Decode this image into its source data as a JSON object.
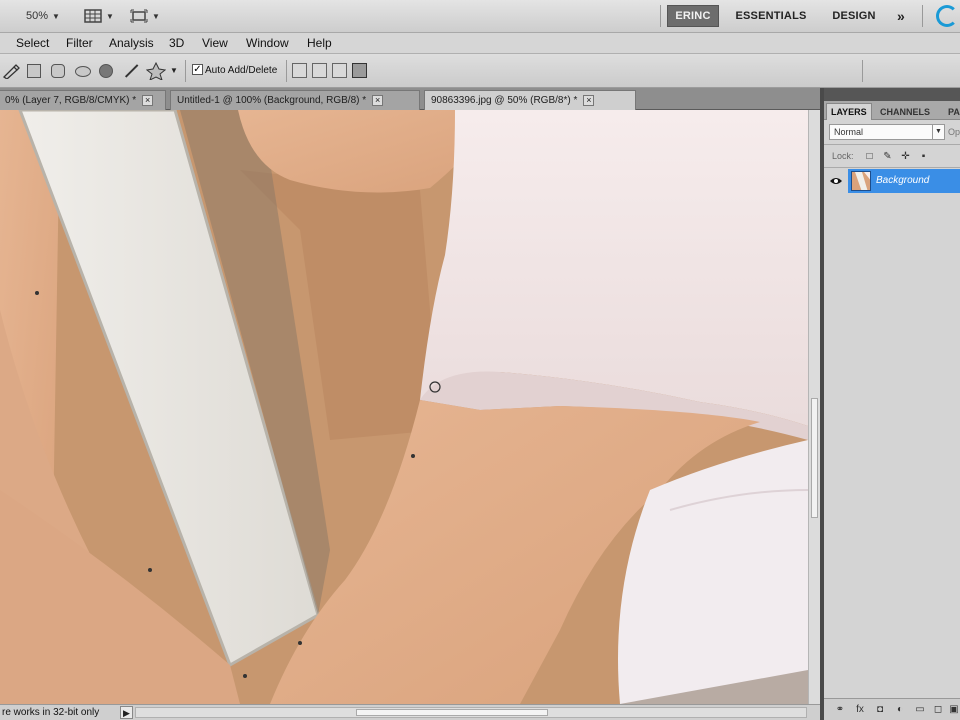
{
  "appbar": {
    "zoom_value": "50%",
    "workspaces": [
      "ERINC",
      "ESSENTIALS",
      "DESIGN"
    ],
    "active_workspace": "ERINC",
    "more_label": "»"
  },
  "menu": [
    "Select",
    "Filter",
    "Analysis",
    "3D",
    "View",
    "Window",
    "Help"
  ],
  "options": {
    "auto_add_delete_checked": true,
    "auto_add_delete_label": "Auto Add/Delete"
  },
  "tabs": [
    {
      "label": "0% (Layer 7, RGB/8/CMYK) *",
      "active": false
    },
    {
      "label": "Untitled-1 @ 100% (Background, RGB/8) *",
      "active": false
    },
    {
      "label": "90863396.jpg @ 50% (RGB/8*) *",
      "active": true
    }
  ],
  "status": {
    "text": "re works in 32-bit only"
  },
  "panel": {
    "tabs": [
      "LAYERS",
      "CHANNELS",
      "PA"
    ],
    "active_tab": "LAYERS",
    "blend_mode": "Normal",
    "opacity_label": "Op",
    "lock_label": "Lock:",
    "layers": [
      {
        "name": "Background",
        "selected": true,
        "visible": true
      }
    ]
  },
  "colors": {
    "selected_layer": "#3a8ee6",
    "active_workspace_bg": "#6d6d6d",
    "cs_live": "#1a9ad6"
  },
  "icons": {
    "view_extras": "view-extras-icon",
    "arrange": "arrange-documents-icon",
    "pen_tool": "pen-tool-icon",
    "rectangle": "rectangle-shape-icon",
    "rounded_rectangle": "rounded-rectangle-icon",
    "ellipse": "ellipse-shape-icon",
    "polygon": "polygon-shape-icon",
    "line": "line-shape-icon",
    "custom_shape": "custom-shape-icon"
  }
}
